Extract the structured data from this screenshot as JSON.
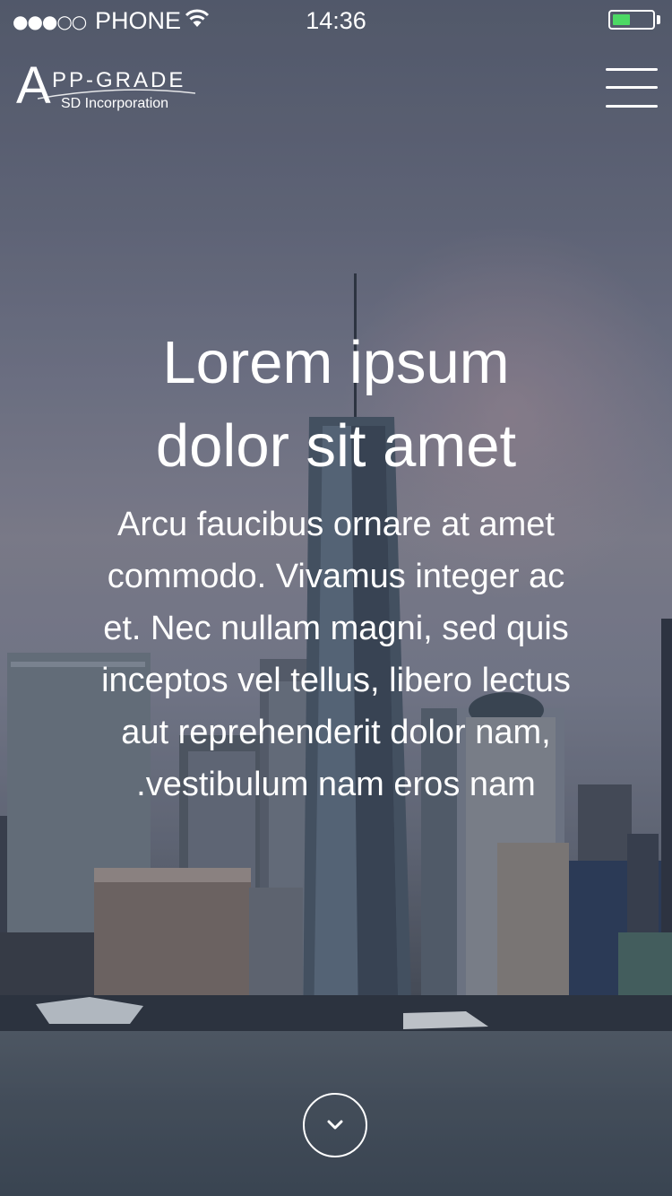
{
  "status_bar": {
    "signal_dots": "●●●○○",
    "carrier": "PHONE",
    "time": "14:36",
    "battery_level": 0.45,
    "battery_color": "#4cd964"
  },
  "header": {
    "logo": {
      "brand_initial": "A",
      "brand_rest": "PP-GRADE",
      "subtitle": "SD Incorporation"
    },
    "menu_icon": "hamburger-icon"
  },
  "hero": {
    "title_line1": "Lorem ipsum",
    "title_line2": "dolor sit amet",
    "body_lines": [
      "Arcu faucibus ornare at amet",
      "commodo. Vivamus integer ac",
      "et. Nec nullam magni, sed quis",
      "inceptos vel tellus, libero lectus",
      "aut reprehenderit dolor nam,",
      ".vestibulum nam eros nam"
    ]
  },
  "scroll_button": {
    "icon": "chevron-down-icon"
  }
}
